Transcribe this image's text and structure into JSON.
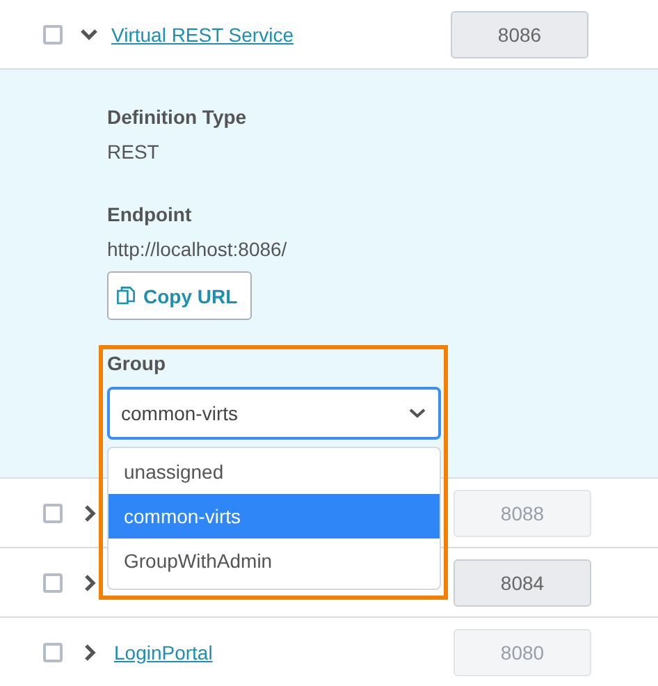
{
  "services": [
    {
      "name": "Virtual REST Service",
      "checked": false,
      "expanded": true,
      "port": "8086",
      "port_disabled": false
    },
    {
      "checked": false,
      "expanded": false,
      "port": "8088",
      "port_disabled": true
    },
    {
      "checked": false,
      "expanded": false,
      "port": "8084",
      "port_disabled": false
    },
    {
      "name": "LoginPortal",
      "checked": false,
      "expanded": false,
      "port": "8080",
      "port_disabled": true
    }
  ],
  "details": {
    "definition_type_label": "Definition Type",
    "definition_type": "REST",
    "endpoint_label": "Endpoint",
    "endpoint": "http://localhost:8086/",
    "copy_button": "Copy URL",
    "group_label": "Group",
    "group_value": "common-virts",
    "group_open": true,
    "group_highlighted": true,
    "group_options": [
      {
        "label": "unassigned",
        "selected": false
      },
      {
        "label": "common-virts",
        "selected": true
      },
      {
        "label": "GroupWithAdmin",
        "selected": false
      }
    ]
  }
}
